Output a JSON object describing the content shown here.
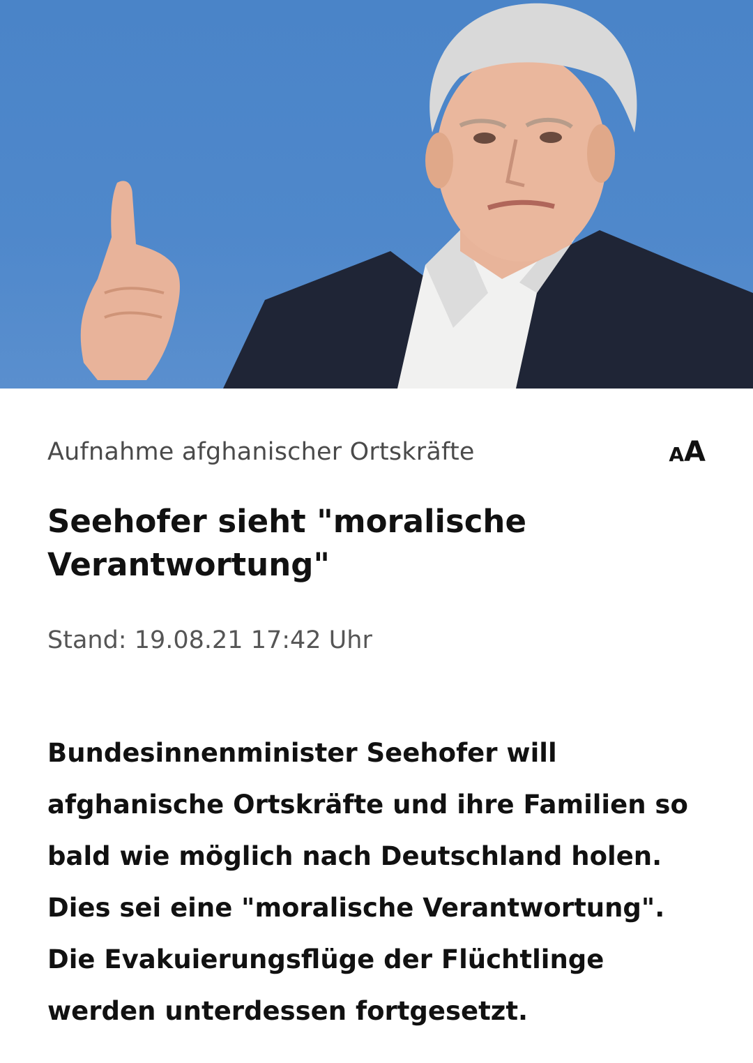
{
  "hero_image": {
    "description_icon": "portrait-photo",
    "background_color": "#4c86c9"
  },
  "article": {
    "topline": "Aufnahme afghanischer Ortskräfte",
    "font_size_toggle": {
      "small": "A",
      "big": "A",
      "icon": "font-size-icon"
    },
    "headline": "Seehofer sieht \"moralische Verantwortung\"",
    "dateline": "Stand: 19.08.21 17:42 Uhr",
    "lead": "Bundesinnenminister Seehofer will afghanische Ortskräfte und ihre Familien so bald wie möglich nach Deutschland holen. Dies sei eine \"moralische Verantwortung\". Die Evakuierungsflüge der Flüchtlinge werden unterdessen fortgesetzt."
  }
}
